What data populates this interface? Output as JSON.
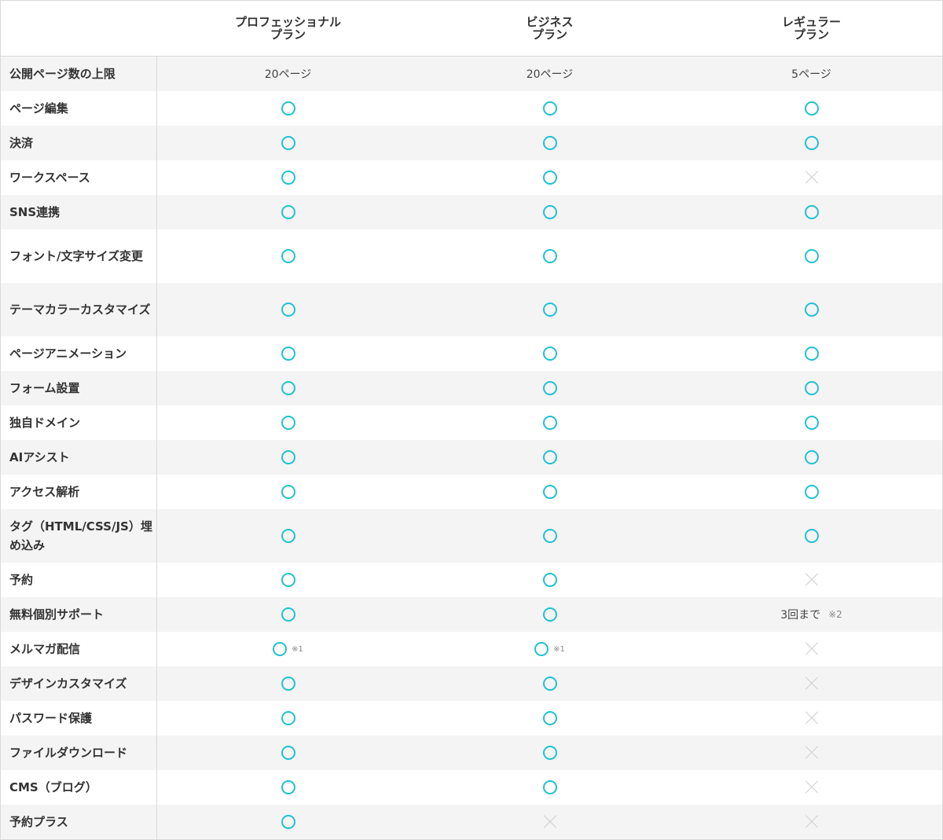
{
  "plans": [
    {
      "name": "プロフェッショナル\nプラン"
    },
    {
      "name": "ビジネス\nプラン"
    },
    {
      "name": "レギュラー\nプラン"
    }
  ],
  "rows": [
    {
      "label": "公開ページ数の上限",
      "h": 44,
      "alt": true,
      "cells": [
        {
          "type": "text",
          "text": "20ページ"
        },
        {
          "type": "text",
          "text": "20ページ"
        },
        {
          "type": "text",
          "text": "5ページ"
        }
      ]
    },
    {
      "label": "ページ編集",
      "h": 44,
      "alt": false,
      "cells": [
        {
          "type": "yes"
        },
        {
          "type": "yes"
        },
        {
          "type": "yes"
        }
      ]
    },
    {
      "label": "決済",
      "h": 44,
      "alt": true,
      "cells": [
        {
          "type": "yes"
        },
        {
          "type": "yes"
        },
        {
          "type": "yes"
        }
      ]
    },
    {
      "label": "ワークスペース",
      "h": 44,
      "alt": false,
      "cells": [
        {
          "type": "yes"
        },
        {
          "type": "yes"
        },
        {
          "type": "no"
        }
      ]
    },
    {
      "label": "SNS連携",
      "h": 44,
      "alt": true,
      "cells": [
        {
          "type": "yes"
        },
        {
          "type": "yes"
        },
        {
          "type": "yes"
        }
      ]
    },
    {
      "label": "フォント/文字サイズ変更",
      "h": 68,
      "alt": false,
      "cells": [
        {
          "type": "yes"
        },
        {
          "type": "yes"
        },
        {
          "type": "yes"
        }
      ]
    },
    {
      "label": "テーマカラーカスタマイズ",
      "h": 68,
      "alt": true,
      "cells": [
        {
          "type": "yes"
        },
        {
          "type": "yes"
        },
        {
          "type": "yes"
        }
      ]
    },
    {
      "label": "ページアニメーション",
      "h": 44,
      "alt": false,
      "cells": [
        {
          "type": "yes"
        },
        {
          "type": "yes"
        },
        {
          "type": "yes"
        }
      ]
    },
    {
      "label": "フォーム設置",
      "h": 44,
      "alt": true,
      "cells": [
        {
          "type": "yes"
        },
        {
          "type": "yes"
        },
        {
          "type": "yes"
        }
      ]
    },
    {
      "label": "独自ドメイン",
      "h": 44,
      "alt": false,
      "cells": [
        {
          "type": "yes"
        },
        {
          "type": "yes"
        },
        {
          "type": "yes"
        }
      ]
    },
    {
      "label": "AIアシスト",
      "h": 44,
      "alt": true,
      "cells": [
        {
          "type": "yes"
        },
        {
          "type": "yes"
        },
        {
          "type": "yes"
        }
      ]
    },
    {
      "label": "アクセス解析",
      "h": 44,
      "alt": false,
      "cells": [
        {
          "type": "yes"
        },
        {
          "type": "yes"
        },
        {
          "type": "yes"
        }
      ]
    },
    {
      "label": "タグ（HTML/CSS/JS）埋め込み",
      "h": 68,
      "alt": true,
      "cells": [
        {
          "type": "yes"
        },
        {
          "type": "yes"
        },
        {
          "type": "yes"
        }
      ]
    },
    {
      "label": "予約",
      "h": 44,
      "alt": false,
      "cells": [
        {
          "type": "yes"
        },
        {
          "type": "yes"
        },
        {
          "type": "no"
        }
      ]
    },
    {
      "label": "無料個別サポート",
      "h": 44,
      "alt": true,
      "cells": [
        {
          "type": "yes"
        },
        {
          "type": "yes"
        },
        {
          "type": "text",
          "text": "3回まで",
          "note": "※2"
        }
      ]
    },
    {
      "label": "メルマガ配信",
      "h": 44,
      "alt": false,
      "cells": [
        {
          "type": "yes",
          "note": "※1"
        },
        {
          "type": "yes",
          "note": "※1"
        },
        {
          "type": "no"
        }
      ]
    },
    {
      "label": "デザインカスタマイズ",
      "h": 44,
      "alt": true,
      "cells": [
        {
          "type": "yes"
        },
        {
          "type": "yes"
        },
        {
          "type": "no"
        }
      ]
    },
    {
      "label": "パスワード保護",
      "h": 44,
      "alt": false,
      "cells": [
        {
          "type": "yes"
        },
        {
          "type": "yes"
        },
        {
          "type": "no"
        }
      ]
    },
    {
      "label": "ファイルダウンロード",
      "h": 44,
      "alt": true,
      "cells": [
        {
          "type": "yes"
        },
        {
          "type": "yes"
        },
        {
          "type": "no"
        }
      ]
    },
    {
      "label": "CMS（ブログ）",
      "h": 44,
      "alt": false,
      "cells": [
        {
          "type": "yes"
        },
        {
          "type": "yes"
        },
        {
          "type": "no"
        }
      ]
    },
    {
      "label": "予約プラス",
      "h": 44,
      "alt": true,
      "cells": [
        {
          "type": "yes"
        },
        {
          "type": "no"
        },
        {
          "type": "no"
        }
      ]
    }
  ]
}
